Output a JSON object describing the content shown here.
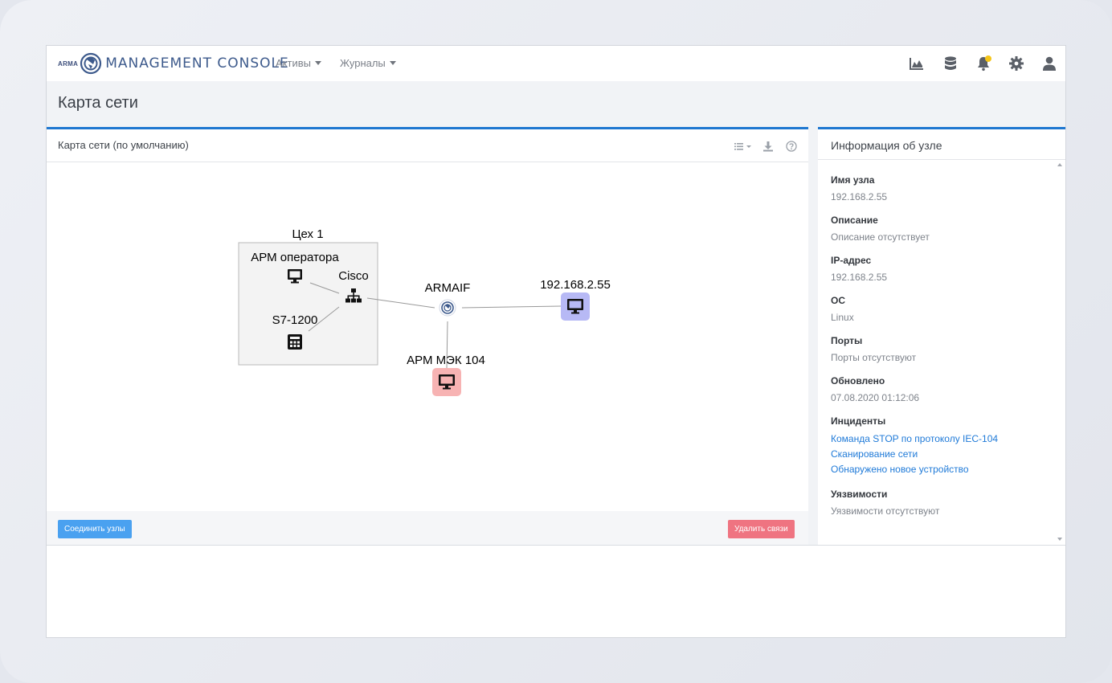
{
  "app": {
    "logo_small": "ARMA",
    "title": "MANAGEMENT CONSOLE"
  },
  "nav": {
    "items": [
      {
        "label": "Активы"
      },
      {
        "label": "Журналы"
      }
    ],
    "icons": [
      "chart-icon",
      "database-icon",
      "bell-icon",
      "gear-icon",
      "user-icon"
    ],
    "notification_badge_color": "#f5c518"
  },
  "page": {
    "title": "Карта сети"
  },
  "map": {
    "panel_title": "Карта сети (по умолчанию)",
    "toolbar_icons": [
      "list-icon",
      "download-icon",
      "help-icon"
    ],
    "group_label": "Цех 1",
    "nodes": {
      "arm_operator": "АРМ оператора",
      "cisco": "Cisco",
      "s7": "S7-1200",
      "armaif": "ARMAIF",
      "ip_node": "192.168.2.55",
      "arm_mek": "АРМ МЭК 104"
    },
    "colors": {
      "accent": "#1f77d0",
      "ip_node_bg": "#b7b9f5",
      "arm_mek_bg": "#f7b3b3"
    },
    "connect_button": "Соединить узлы",
    "delete_button": "Удалить связи"
  },
  "info": {
    "panel_title": "Информация об узле",
    "node_name_label": "Имя узла",
    "node_name_value": "192.168.2.55",
    "description_label": "Описание",
    "description_value": "Описание отсутствует",
    "ip_label": "IP-адрес",
    "ip_value": "192.168.2.55",
    "os_label": "ОС",
    "os_value": "Linux",
    "ports_label": "Порты",
    "ports_value": "Порты отсутствуют",
    "updated_label": "Обновлено",
    "updated_value": "07.08.2020 01:12:06",
    "incidents_label": "Инциденты",
    "incidents": [
      "Команда STOP по протоколу IEC-104",
      "Сканирование сети",
      "Обнаружено новое устройство"
    ],
    "vulns_label": "Уязвимости",
    "vulns_value": "Уязвимости отсутствуют"
  }
}
